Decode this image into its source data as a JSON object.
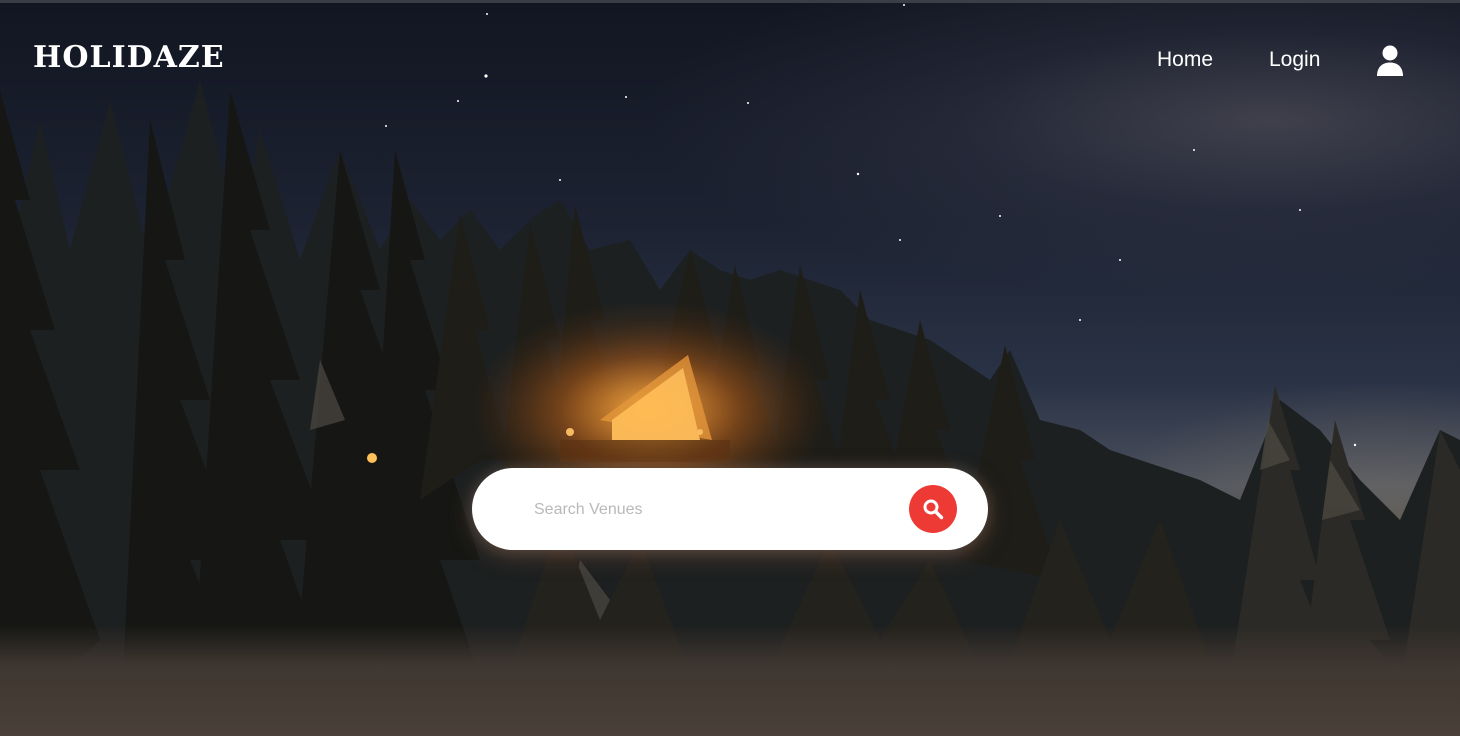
{
  "brand": {
    "name": "HOLIDAZE"
  },
  "nav": {
    "home_label": "Home",
    "login_label": "Login",
    "user_icon": "user-icon"
  },
  "search": {
    "placeholder": "Search Venues",
    "value": "",
    "button_icon": "search-icon",
    "button_color": "#ee3a35"
  },
  "colors": {
    "accent": "#ee3a35",
    "text": "#ffffff"
  }
}
